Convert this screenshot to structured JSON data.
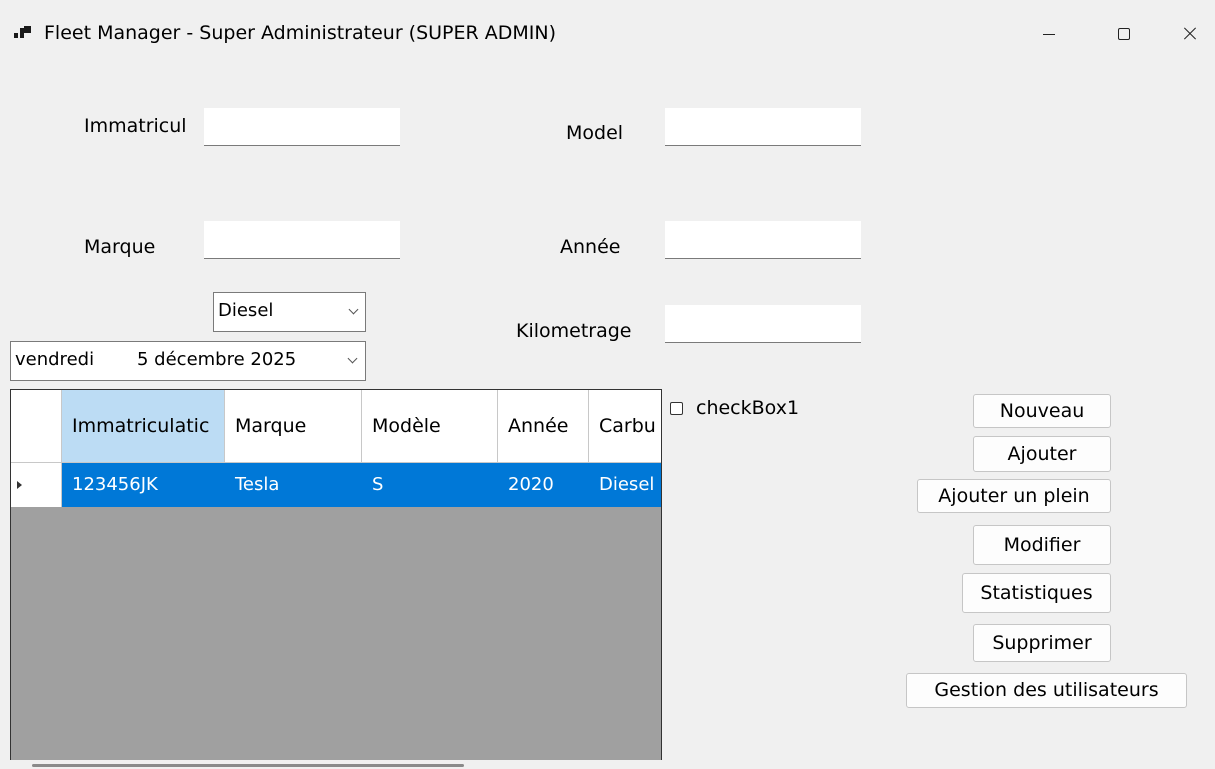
{
  "window": {
    "title": "Fleet Manager - Super Administrateur (SUPER ADMIN)",
    "icon": "app-window-icon"
  },
  "form": {
    "immatriculation_label": "Immatricul",
    "immatriculation_value": "",
    "marque_label": "Marque",
    "marque_value": "",
    "model_label": "Model",
    "model_value": "",
    "annee_label": "Année",
    "annee_value": "",
    "kilometrage_label": "Kilometrage",
    "kilometrage_value": "",
    "carburant_selected": "Diesel",
    "date_weekday": "vendredi",
    "date_value": "5 décembre 2025",
    "checkbox_label": "checkBox1",
    "checkbox_checked": false
  },
  "grid": {
    "columns": [
      "Immatriculatic",
      "Marque",
      "Modèle",
      "Année",
      "Carbu"
    ],
    "rows": [
      [
        "123456JK",
        "Tesla",
        "S",
        "2020",
        "Diesel"
      ]
    ],
    "selected_row": 0
  },
  "buttons": {
    "nouveau": "Nouveau",
    "ajouter": "Ajouter",
    "ajouter_plein": "Ajouter un plein",
    "modifier": "Modifier",
    "statistiques": "Statistiques",
    "supprimer": "Supprimer",
    "gestion_utilisateurs": "Gestion des utilisateurs"
  },
  "colors": {
    "selection": "#0078d7",
    "header_selected": "#bcdcf4",
    "grid_background": "#a0a0a0",
    "window_background": "#f0f0f0"
  }
}
